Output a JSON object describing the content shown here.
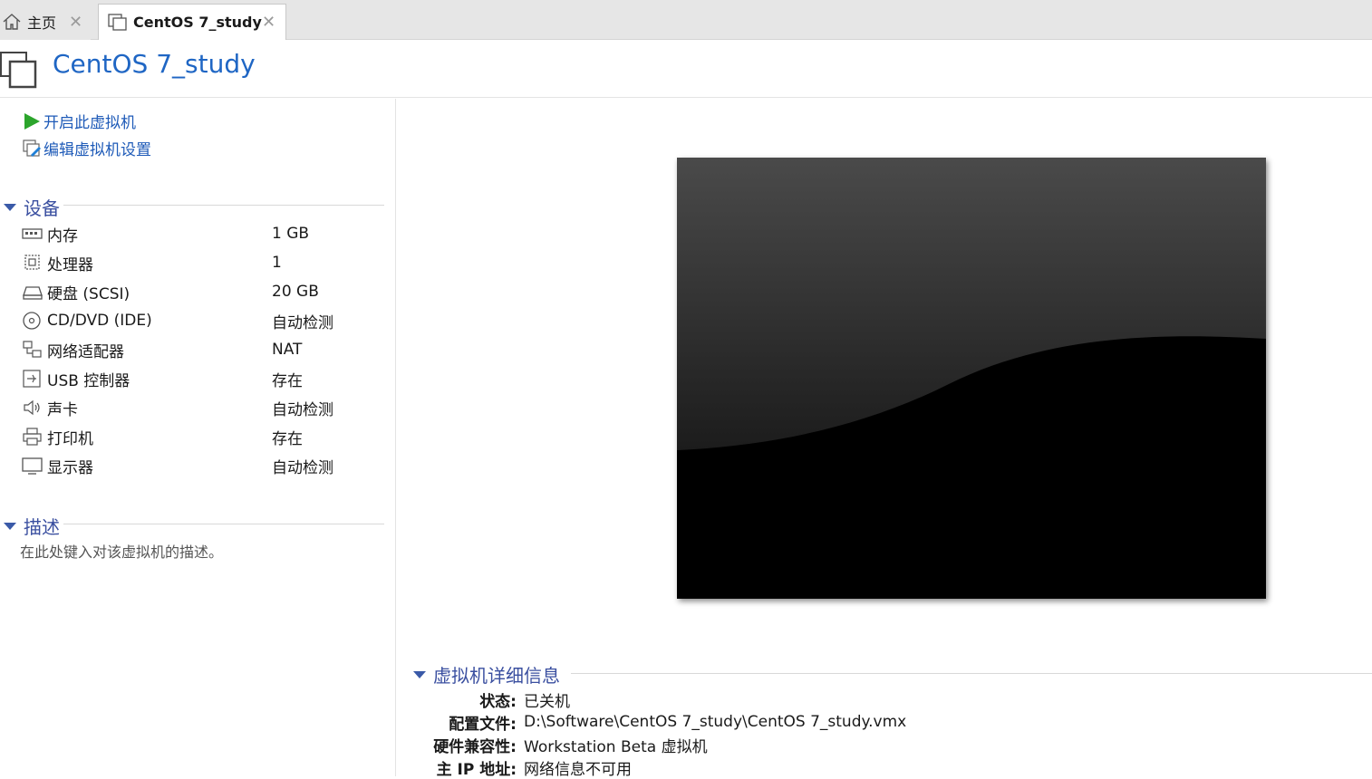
{
  "tabs": [
    {
      "label": "主页",
      "icon": "home-icon"
    },
    {
      "label": "CentOS 7_study",
      "icon": "vm-icon"
    }
  ],
  "title": "CentOS 7_study",
  "actions": {
    "start": "开启此虚拟机",
    "edit": "编辑虚拟机设置"
  },
  "devices_section": "设备",
  "devices": [
    {
      "name": "内存",
      "value": "1 GB",
      "icon": "memory-icon"
    },
    {
      "name": "处理器",
      "value": "1",
      "icon": "cpu-icon"
    },
    {
      "name": "硬盘 (SCSI)",
      "value": "20 GB",
      "icon": "harddisk-icon"
    },
    {
      "name": "CD/DVD (IDE)",
      "value": "自动检测",
      "icon": "cd-icon"
    },
    {
      "name": "网络适配器",
      "value": "NAT",
      "icon": "network-icon"
    },
    {
      "name": "USB 控制器",
      "value": "存在",
      "icon": "usb-icon"
    },
    {
      "name": "声卡",
      "value": "自动检测",
      "icon": "speaker-icon"
    },
    {
      "name": "打印机",
      "value": "存在",
      "icon": "printer-icon"
    },
    {
      "name": "显示器",
      "value": "自动检测",
      "icon": "monitor-icon"
    }
  ],
  "description_section": "描述",
  "description_placeholder": "在此处键入对该虚拟机的描述。",
  "details_section": "虚拟机详细信息",
  "details": [
    {
      "key": "状态:",
      "value": "已关机"
    },
    {
      "key": "配置文件:",
      "value": "D:\\Software\\CentOS 7_study\\CentOS 7_study.vmx"
    },
    {
      "key": "硬件兼容性:",
      "value": "Workstation Beta 虚拟机"
    },
    {
      "key": "主 IP 地址:",
      "value": "网络信息不可用"
    }
  ],
  "colors": {
    "accent": "#1f66c4",
    "section": "#3a4fa0",
    "play": "#2ca52c"
  }
}
